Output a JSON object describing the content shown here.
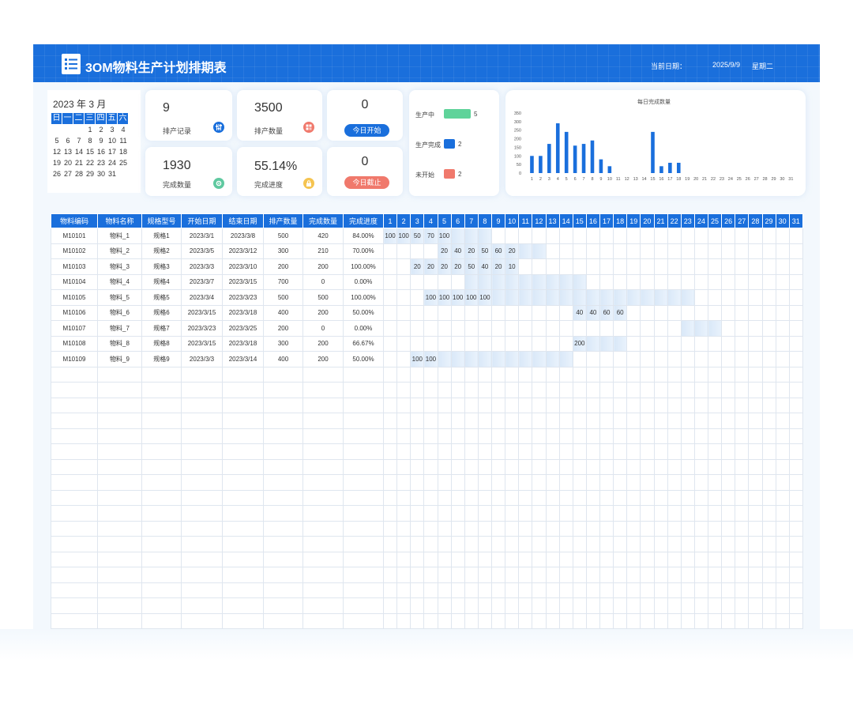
{
  "header": {
    "title": "3OM物料生产计划排期表",
    "date_label": "当前日期：",
    "date_value": "2025/9/9",
    "weekday": "星期二"
  },
  "calendar": {
    "title": "2023 年 3 月",
    "weekdays": [
      "日",
      "一",
      "二",
      "三",
      "四",
      "五",
      "六"
    ],
    "leading_blanks": 3,
    "days": 31
  },
  "stats": {
    "records": {
      "value": "9",
      "label": "排产记录"
    },
    "quantity": {
      "value": "3500",
      "label": "排产数量"
    },
    "completed": {
      "value": "1930",
      "label": "完成数量"
    },
    "progress": {
      "value": "55.14%",
      "label": "完成进度"
    },
    "today_start": {
      "value": "0",
      "label": "今日开始"
    },
    "today_end": {
      "value": "0",
      "label": "今日截止"
    }
  },
  "status": [
    {
      "label": "生产中",
      "value": "5",
      "color": "#5fd39a"
    },
    {
      "label": "生产完成",
      "value": "2",
      "color": "#1a6fdc"
    },
    {
      "label": "未开始",
      "value": "2",
      "color": "#f0796c"
    }
  ],
  "chart_data": {
    "type": "bar",
    "title": "每日完成数量",
    "categories": [
      "1",
      "2",
      "3",
      "4",
      "5",
      "6",
      "7",
      "8",
      "9",
      "10",
      "11",
      "12",
      "13",
      "14",
      "15",
      "16",
      "17",
      "18",
      "19",
      "20",
      "21",
      "22",
      "23",
      "24",
      "25",
      "26",
      "27",
      "28",
      "29",
      "30",
      "31"
    ],
    "values": [
      100,
      100,
      170,
      290,
      240,
      160,
      170,
      190,
      80,
      40,
      0,
      0,
      0,
      0,
      240,
      40,
      60,
      60,
      0,
      0,
      0,
      0,
      0,
      0,
      0,
      0,
      0,
      0,
      0,
      0,
      0
    ],
    "ylim": [
      0,
      350
    ],
    "yticks": [
      0,
      50,
      100,
      150,
      200,
      250,
      300,
      350
    ],
    "color": "#1a6fdc",
    "grid": false
  },
  "table": {
    "columns": [
      "物料编码",
      "物料名称",
      "规格型号",
      "开始日期",
      "结束日期",
      "排产数量",
      "完成数量",
      "完成进度"
    ],
    "day_count": 31,
    "empty_rows": 17,
    "rows": [
      {
        "code": "M10101",
        "name": "物料_1",
        "spec": "规格1",
        "start": "2023/3/1",
        "end": "2023/3/8",
        "plan": "500",
        "done": "420",
        "progress": "84.00%",
        "start_day": 1,
        "end_day": 8,
        "daily": {
          "1": "100",
          "2": "100",
          "3": "50",
          "4": "70",
          "5": "100"
        }
      },
      {
        "code": "M10102",
        "name": "物料_2",
        "spec": "规格2",
        "start": "2023/3/5",
        "end": "2023/3/12",
        "plan": "300",
        "done": "210",
        "progress": "70.00%",
        "start_day": 5,
        "end_day": 12,
        "daily": {
          "5": "20",
          "6": "40",
          "7": "20",
          "8": "50",
          "9": "60",
          "10": "20"
        }
      },
      {
        "code": "M10103",
        "name": "物料_3",
        "spec": "规格3",
        "start": "2023/3/3",
        "end": "2023/3/10",
        "plan": "200",
        "done": "200",
        "progress": "100.00%",
        "start_day": 3,
        "end_day": 10,
        "daily": {
          "3": "20",
          "4": "20",
          "5": "20",
          "6": "20",
          "7": "50",
          "8": "40",
          "9": "20",
          "10": "10"
        }
      },
      {
        "code": "M10104",
        "name": "物料_4",
        "spec": "规格4",
        "start": "2023/3/7",
        "end": "2023/3/15",
        "plan": "700",
        "done": "0",
        "progress": "0.00%",
        "start_day": 7,
        "end_day": 15,
        "daily": {}
      },
      {
        "code": "M10105",
        "name": "物料_5",
        "spec": "规格5",
        "start": "2023/3/4",
        "end": "2023/3/23",
        "plan": "500",
        "done": "500",
        "progress": "100.00%",
        "start_day": 4,
        "end_day": 23,
        "daily": {
          "4": "100",
          "5": "100",
          "6": "100",
          "7": "100",
          "8": "100"
        }
      },
      {
        "code": "M10106",
        "name": "物料_6",
        "spec": "规格6",
        "start": "2023/3/15",
        "end": "2023/3/18",
        "plan": "400",
        "done": "200",
        "progress": "50.00%",
        "start_day": 15,
        "end_day": 18,
        "daily": {
          "15": "40",
          "16": "40",
          "17": "60",
          "18": "60"
        }
      },
      {
        "code": "M10107",
        "name": "物料_7",
        "spec": "规格7",
        "start": "2023/3/23",
        "end": "2023/3/25",
        "plan": "200",
        "done": "0",
        "progress": "0.00%",
        "start_day": 23,
        "end_day": 25,
        "daily": {}
      },
      {
        "code": "M10108",
        "name": "物料_8",
        "spec": "规格8",
        "start": "2023/3/15",
        "end": "2023/3/18",
        "plan": "300",
        "done": "200",
        "progress": "66.67%",
        "start_day": 15,
        "end_day": 18,
        "daily": {
          "15": "200"
        }
      },
      {
        "code": "M10109",
        "name": "物料_9",
        "spec": "规格9",
        "start": "2023/3/3",
        "end": "2023/3/14",
        "plan": "400",
        "done": "200",
        "progress": "50.00%",
        "start_day": 3,
        "end_day": 14,
        "daily": {
          "3": "100",
          "4": "100"
        }
      }
    ]
  }
}
